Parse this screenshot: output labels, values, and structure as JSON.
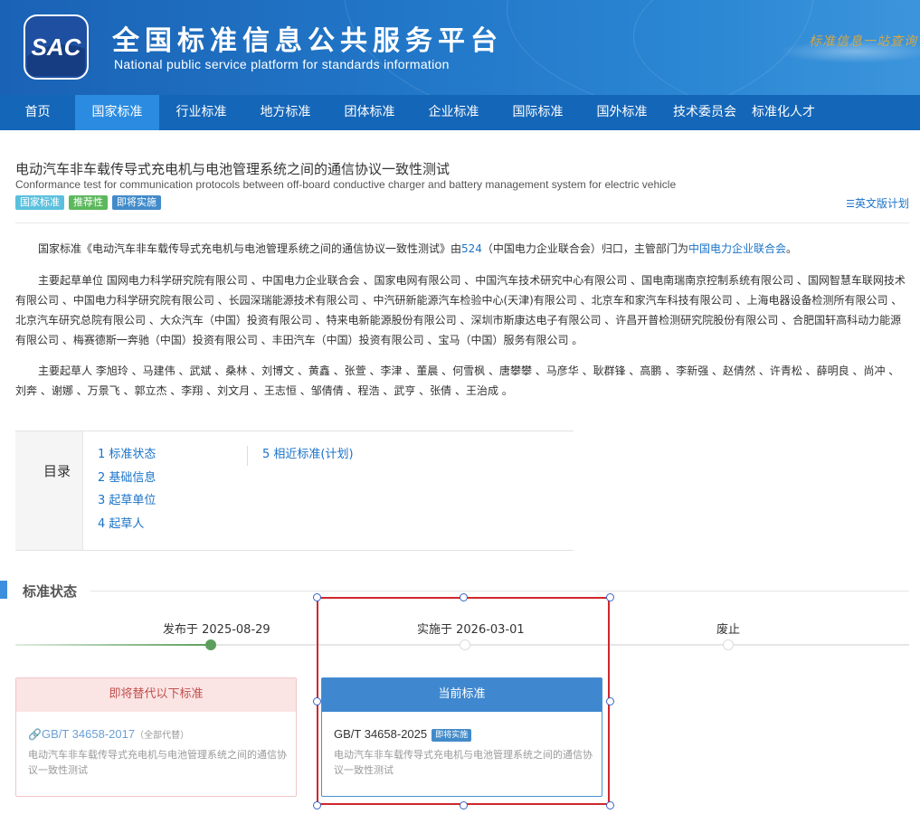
{
  "header": {
    "logo_text": "SAC",
    "title_cn": "全国标准信息公共服务平台",
    "title_en": "National public service platform  for standards information",
    "slogan": "标准信息一站查询"
  },
  "nav": {
    "items": [
      {
        "label": "首页"
      },
      {
        "label": "国家标准",
        "active": true
      },
      {
        "label": "行业标准"
      },
      {
        "label": "地方标准"
      },
      {
        "label": "团体标准"
      },
      {
        "label": "企业标准"
      },
      {
        "label": "国际标准"
      },
      {
        "label": "国外标准"
      },
      {
        "label": "技术委员会"
      },
      {
        "label": "标准化人才"
      }
    ]
  },
  "standard": {
    "title_cn": "电动汽车非车载传导式充电机与电池管理系统之间的通信协议一致性测试",
    "title_en": "Conformance test for communication protocols between off-board conductive charger and battery management system for electric vehicle",
    "tags": [
      {
        "label": "国家标准",
        "color": "#5bc0de"
      },
      {
        "label": "推荐性",
        "color": "#5cb85c"
      },
      {
        "label": "即将实施",
        "color": "#428bca"
      }
    ],
    "english_link": "英文版计划"
  },
  "intro": {
    "prefix": "国家标准《电动汽车非车载传导式充电机与电池管理系统之间的通信协议一致性测试》由",
    "tc_code": "524",
    "middle": "（中国电力企业联合会）归口，主管部门为",
    "dept": "中国电力企业联合会",
    "suffix": "。"
  },
  "drafting_units": "主要起草单位 国网电力科学研究院有限公司 、中国电力企业联合会 、国家电网有限公司 、中国汽车技术研究中心有限公司 、国电南瑞南京控制系统有限公司 、国网智慧车联网技术有限公司 、中国电力科学研究院有限公司 、长园深瑞能源技术有限公司 、中汽研新能源汽车检验中心(天津)有限公司 、北京车和家汽车科技有限公司 、上海电器设备检测所有限公司 、北京汽车研究总院有限公司 、大众汽车（中国）投资有限公司 、特来电新能源股份有限公司 、深圳市斯康达电子有限公司 、许昌开普检测研究院股份有限公司 、合肥国轩高科动力能源有限公司 、梅赛德斯一奔驰（中国）投资有限公司 、丰田汽车（中国）投资有限公司 、宝马（中国）服务有限公司 。",
  "drafters": "主要起草人 李旭玲 、马建伟 、武斌 、桑林 、刘博文 、黄鑫 、张萱 、李津 、董晨 、何雪枫 、唐攀攀 、马彦华 、耿群锋 、高鹏 、李新强 、赵倩然 、许青松 、薛明良 、尚冲 、刘奔 、谢娜 、万景飞 、郭立杰 、李翔 、刘文月 、王志恒 、邹倩倩 、程浩 、武亨 、张倩 、王治成 。",
  "toc": {
    "heading": "目录",
    "col1": [
      "1  标准状态",
      "2  基础信息",
      "3  起草单位",
      "4  起草人"
    ],
    "col2": [
      "5  相近标准(计划)"
    ]
  },
  "status": {
    "section_title": "标准状态",
    "timeline": [
      {
        "label": "发布于 2025-08-29",
        "reached": true
      },
      {
        "label": "实施于 2026-03-01",
        "reached": false
      },
      {
        "label": "废止",
        "reached": false
      }
    ],
    "replace_card": {
      "title": "即将替代以下标准",
      "code": "GB/T 34658-2017",
      "note": "（全部代替）",
      "desc": "电动汽车非车载传导式充电机与电池管理系统之间的通信协议一致性测试"
    },
    "current_card": {
      "title": "当前标准",
      "code": "GB/T 34658-2025",
      "badge": "即将实施",
      "desc": "电动汽车非车载传导式充电机与电池管理系统之间的通信协议一致性测试"
    }
  }
}
